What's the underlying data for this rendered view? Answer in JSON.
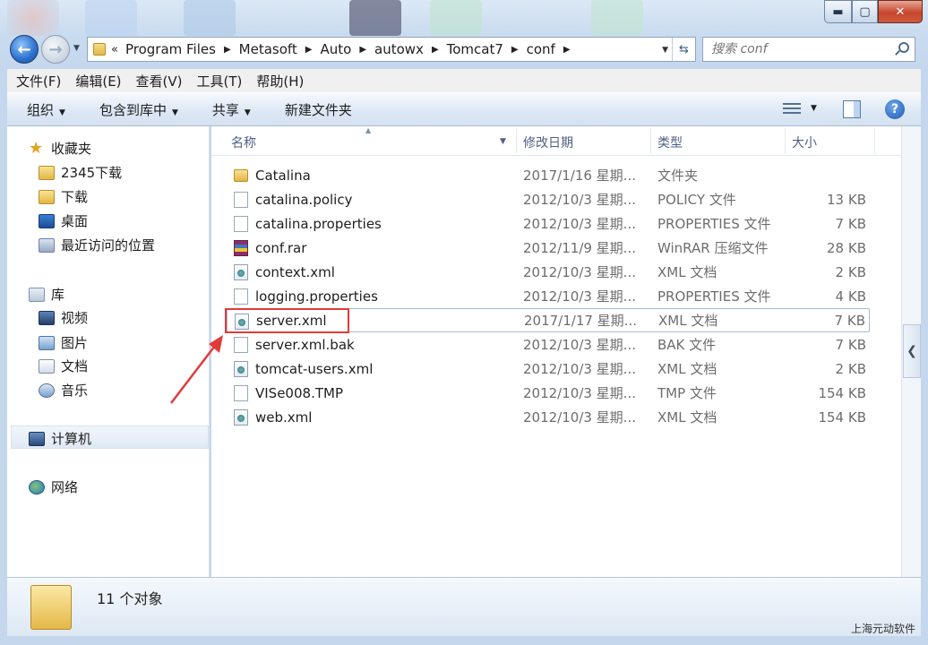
{
  "window": {
    "min_label": "▬",
    "max_label": "▢",
    "close_label": "✕"
  },
  "address": {
    "overflow": "«",
    "crumbs": [
      "Program Files",
      "Metasoft",
      "Auto",
      "autowx",
      "Tomcat7",
      "conf"
    ]
  },
  "search": {
    "placeholder": "搜索 conf"
  },
  "menu": [
    "文件(F)",
    "编辑(E)",
    "查看(V)",
    "工具(T)",
    "帮助(H)"
  ],
  "commands": {
    "organize": "组织",
    "include_library": "包含到库中",
    "share": "共享",
    "new_folder": "新建文件夹"
  },
  "nav": {
    "favorites": "收藏夹",
    "fav_items": [
      "2345下载",
      "下载",
      "桌面",
      "最近访问的位置"
    ],
    "libraries": "库",
    "lib_items": [
      "视频",
      "图片",
      "文档",
      "音乐"
    ],
    "computer": "计算机",
    "network": "网络"
  },
  "columns": {
    "name": "名称",
    "modified": "修改日期",
    "type": "类型",
    "size": "大小"
  },
  "files": [
    {
      "name": "Catalina",
      "date": "2017/1/16 星期...",
      "type": "文件夹",
      "size": "",
      "icon": "folder-icon"
    },
    {
      "name": "catalina.policy",
      "date": "2012/10/3 星期...",
      "type": "POLICY 文件",
      "size": "13 KB",
      "icon": "file-icon"
    },
    {
      "name": "catalina.properties",
      "date": "2012/10/3 星期...",
      "type": "PROPERTIES 文件",
      "size": "7 KB",
      "icon": "file-icon"
    },
    {
      "name": "conf.rar",
      "date": "2012/11/9 星期...",
      "type": "WinRAR 压缩文件",
      "size": "28 KB",
      "icon": "rar-icon"
    },
    {
      "name": "context.xml",
      "date": "2012/10/3 星期...",
      "type": "XML 文档",
      "size": "2 KB",
      "icon": "xml-icon"
    },
    {
      "name": "logging.properties",
      "date": "2012/10/3 星期...",
      "type": "PROPERTIES 文件",
      "size": "4 KB",
      "icon": "file-icon"
    },
    {
      "name": "server.xml",
      "date": "2017/1/17 星期...",
      "type": "XML 文档",
      "size": "7 KB",
      "icon": "xml-icon"
    },
    {
      "name": "server.xml.bak",
      "date": "2012/10/3 星期...",
      "type": "BAK 文件",
      "size": "7 KB",
      "icon": "file-icon"
    },
    {
      "name": "tomcat-users.xml",
      "date": "2012/10/3 星期...",
      "type": "XML 文档",
      "size": "2 KB",
      "icon": "xml-icon"
    },
    {
      "name": "VISe008.TMP",
      "date": "2012/10/3 星期...",
      "type": "TMP 文件",
      "size": "154 KB",
      "icon": "file-icon"
    },
    {
      "name": "web.xml",
      "date": "2012/10/3 星期...",
      "type": "XML 文档",
      "size": "154 KB",
      "icon": "xml-icon"
    }
  ],
  "status": {
    "count": "11 个对象"
  },
  "watermark": "上海元动软件",
  "colors": {
    "highlight": "#e23a3a",
    "accent": "#2a6fcb"
  }
}
